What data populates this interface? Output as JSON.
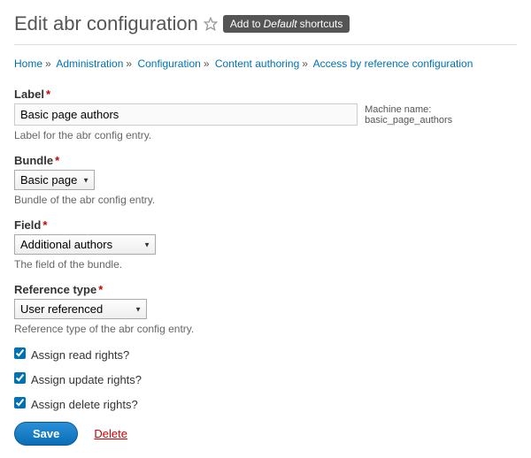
{
  "header": {
    "title": "Edit abr configuration",
    "shortcut_prefix": "Add to",
    "shortcut_em": "Default",
    "shortcut_suffix": "shortcuts"
  },
  "breadcrumb": [
    "Home",
    "Administration",
    "Configuration",
    "Content authoring",
    "Access by reference configuration"
  ],
  "form": {
    "label": {
      "title": "Label",
      "value": "Basic page authors",
      "desc": "Label for the abr config entry.",
      "machine_label": "Machine name:",
      "machine_value": "basic_page_authors"
    },
    "bundle": {
      "title": "Bundle",
      "value": "Basic page",
      "desc": "Bundle of the abr config entry."
    },
    "field": {
      "title": "Field",
      "value": "Additional authors",
      "desc": "The field of the bundle."
    },
    "reftype": {
      "title": "Reference type",
      "value": "User referenced",
      "desc": "Reference type of the abr config entry."
    },
    "rights": {
      "read": "Assign read rights?",
      "update": "Assign update rights?",
      "delete": "Assign delete rights?"
    }
  },
  "actions": {
    "save": "Save",
    "delete": "Delete"
  }
}
